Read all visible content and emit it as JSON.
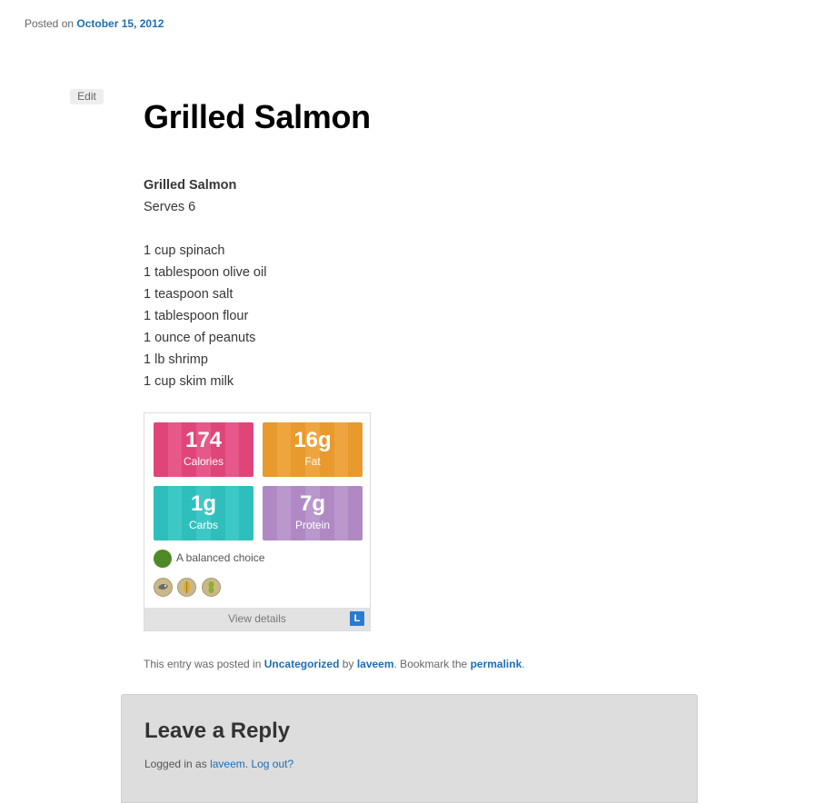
{
  "post": {
    "posted_prefix": "Posted on",
    "date": "October 15, 2012",
    "edit_label": "Edit",
    "title": "Grilled Salmon"
  },
  "recipe": {
    "name": "Grilled Salmon",
    "serves": "Serves 6",
    "ingredients": [
      "1 cup spinach",
      "1 tablespoon olive oil",
      "1 teaspoon salt",
      "1 tablespoon flour",
      "1 ounce of peanuts",
      "1 lb shrimp",
      "1 cup skim milk"
    ]
  },
  "nutrition": {
    "tiles": [
      {
        "value": "174",
        "label": "Calories",
        "color_a": "#e0457a",
        "color_b": "#e65889"
      },
      {
        "value": "16g",
        "label": "Fat",
        "color_a": "#e89a2c",
        "color_b": "#eea53e"
      },
      {
        "value": "1g",
        "label": "Carbs",
        "color_a": "#2ebfbc",
        "color_b": "#3ec8c5"
      },
      {
        "value": "7g",
        "label": "Protein",
        "color_a": "#b089c4",
        "color_b": "#ba97cc"
      }
    ],
    "balanced_text": "A balanced choice",
    "balanced_color": "#4e8a25",
    "badges": [
      "fish-badge-icon",
      "wheat-badge-icon",
      "peanut-badge-icon"
    ],
    "view_details": "View details",
    "brand_letter": "L"
  },
  "entry_meta": {
    "prefix": "This entry was posted in",
    "category": "Uncategorized",
    "by": "by",
    "author": "laveem",
    "bookmark": ". Bookmark the",
    "permalink": "permalink",
    "end": "."
  },
  "reply": {
    "title": "Leave a Reply",
    "logged_prefix": "Logged in as",
    "user": "laveem",
    "logout": "Log out?"
  }
}
